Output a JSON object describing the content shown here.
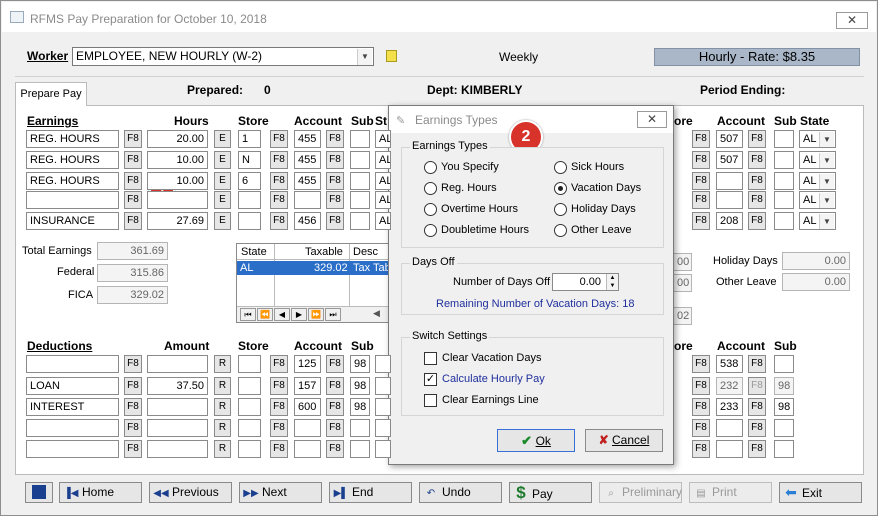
{
  "window": {
    "title": "RFMS Pay Preparation for October 10, 2018",
    "close": "✕"
  },
  "top": {
    "worker_label": "Worker",
    "worker_value": "EMPLOYEE, NEW HOURLY (W-2)",
    "frequency": "Weekly",
    "rate": "Hourly - Rate: $8.35"
  },
  "tab": {
    "label": "Prepare Pay"
  },
  "info": {
    "prepared_label": "Prepared:",
    "prepared_value": "0",
    "dept": "Dept: KIMBERLY",
    "period_ending": "Period Ending:"
  },
  "earnings": {
    "headers": {
      "earnings": "Earnings",
      "hours": "Hours",
      "store": "Store",
      "account": "Account",
      "sub": "Sub",
      "state_short": "St"
    },
    "rows": [
      {
        "code": "REG. HOURS",
        "hours": "20.00",
        "store": "1",
        "account": "455",
        "state": "AL"
      },
      {
        "code": "REG. HOURS",
        "hours": "10.00",
        "store": "N",
        "account": "455",
        "state": "AL"
      },
      {
        "code": "REG. HOURS",
        "hours": "10.00",
        "store": "6",
        "account": "455",
        "state": "AL"
      },
      {
        "code": "",
        "hours": "",
        "store": "",
        "account": "",
        "state": "AL"
      },
      {
        "code": "INSURANCE",
        "hours": "27.69",
        "store": "",
        "account": "456",
        "state": "AL"
      }
    ],
    "right": {
      "headers": {
        "store_part": "ore",
        "account": "Account",
        "sub_state": "Sub State"
      },
      "rows": [
        {
          "account": "507",
          "state": "AL"
        },
        {
          "account": "507",
          "state": "AL"
        },
        {
          "account": "",
          "state": "AL"
        },
        {
          "account": "",
          "state": "AL"
        },
        {
          "account": "208",
          "state": "AL"
        }
      ]
    }
  },
  "totals": {
    "total_label": "Total Earnings",
    "total": "361.69",
    "federal_label": "Federal",
    "federal": "315.86",
    "fica_label": "FICA",
    "fica": "329.02"
  },
  "tax_grid": {
    "headers": [
      "State",
      "Taxable",
      "Desc"
    ],
    "row": {
      "state": "AL",
      "taxable": "329.02",
      "desc": "Tax Tab"
    },
    "nav": [
      "⏮",
      "⏪",
      "◀",
      "▶",
      "⏩",
      "⏭"
    ]
  },
  "right_totals": {
    "holiday_label": "Holiday Days",
    "holiday": "0.00",
    "other_label": "Other Leave",
    "other": "0.00",
    "f1": "00",
    "f2": "00",
    "f3": "02"
  },
  "deductions": {
    "headers": {
      "deductions": "Deductions",
      "amount": "Amount",
      "store": "Store",
      "account": "Account",
      "sub": "Sub"
    },
    "rows": [
      {
        "code": "",
        "amount": "",
        "account": "125",
        "sub": "98"
      },
      {
        "code": "LOAN",
        "amount": "37.50",
        "account": "157",
        "sub": "98"
      },
      {
        "code": "INTEREST",
        "amount": "",
        "account": "600",
        "sub": "98"
      },
      {
        "code": "",
        "amount": "",
        "account": "",
        "sub": ""
      },
      {
        "code": "",
        "amount": "",
        "account": "",
        "sub": ""
      }
    ],
    "right": {
      "headers": {
        "store_part": "ore",
        "account": "Account",
        "sub": "Sub"
      },
      "rows": [
        {
          "account": "538",
          "sub": ""
        },
        {
          "account": "232",
          "sub": "98"
        },
        {
          "account": "233",
          "sub": "98"
        },
        {
          "account": "",
          "sub": ""
        },
        {
          "account": "",
          "sub": ""
        }
      ]
    }
  },
  "buttons": {
    "f8": "F8",
    "e": "E",
    "r": "R"
  },
  "nav": {
    "home": "Home",
    "previous": "Previous",
    "next": "Next",
    "end": "End",
    "undo": "Undo",
    "pay": "Pay",
    "preliminary": "Preliminary",
    "print": "Print",
    "exit": "Exit"
  },
  "dialog": {
    "title": "Earnings Types",
    "earnings_group": "Earnings Types",
    "options": [
      "You Specify",
      "Sick Hours",
      "Reg. Hours",
      "Vacation Days",
      "Overtime Hours",
      "Holiday Days",
      "Doubletime Hours",
      "Other Leave"
    ],
    "selected": "Vacation Days",
    "days_group": "Days Off",
    "days_label": "Number of Days Off",
    "days_value": "0.00",
    "remaining": "Remaining Number of Vacation Days: 18",
    "switch_group": "Switch Settings",
    "switches": [
      {
        "label": "Clear Vacation Days",
        "checked": false
      },
      {
        "label": "Calculate Hourly Pay",
        "checked": true
      },
      {
        "label": "Clear Earnings Line",
        "checked": false
      }
    ],
    "ok": "Ok",
    "cancel": "Cancel"
  },
  "badges": {
    "one": "1",
    "two": "2"
  }
}
